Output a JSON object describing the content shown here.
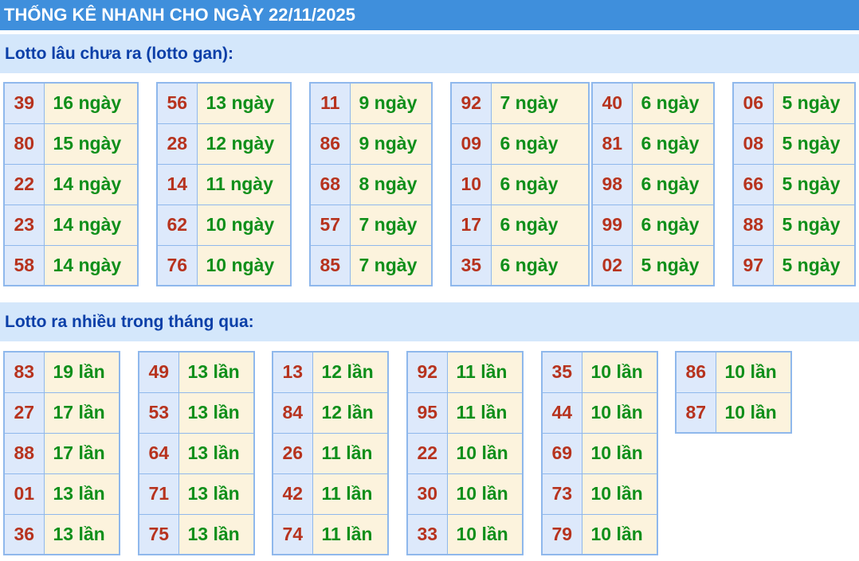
{
  "title": "THỐNG KÊ NHANH CHO NGÀY 22/11/2025",
  "gan": {
    "heading": "Lotto lâu chưa ra (lotto gan):",
    "tables": [
      [
        [
          "39",
          "16 ngày"
        ],
        [
          "80",
          "15 ngày"
        ],
        [
          "22",
          "14 ngày"
        ],
        [
          "23",
          "14 ngày"
        ],
        [
          "58",
          "14 ngày"
        ]
      ],
      [
        [
          "56",
          "13 ngày"
        ],
        [
          "28",
          "12 ngày"
        ],
        [
          "14",
          "11 ngày"
        ],
        [
          "62",
          "10 ngày"
        ],
        [
          "76",
          "10 ngày"
        ]
      ],
      [
        [
          "11",
          "9 ngày"
        ],
        [
          "86",
          "9 ngày"
        ],
        [
          "68",
          "8 ngày"
        ],
        [
          "57",
          "7 ngày"
        ],
        [
          "85",
          "7 ngày"
        ]
      ],
      [
        [
          "92",
          "7 ngày"
        ],
        [
          "09",
          "6 ngày"
        ],
        [
          "10",
          "6 ngày"
        ],
        [
          "17",
          "6 ngày"
        ],
        [
          "35",
          "6 ngày"
        ]
      ],
      [
        [
          "40",
          "6 ngày"
        ],
        [
          "81",
          "6 ngày"
        ],
        [
          "98",
          "6 ngày"
        ],
        [
          "99",
          "6 ngày"
        ],
        [
          "02",
          "5 ngày"
        ]
      ],
      [
        [
          "06",
          "5 ngày"
        ],
        [
          "08",
          "5 ngày"
        ],
        [
          "66",
          "5 ngày"
        ],
        [
          "88",
          "5 ngày"
        ],
        [
          "97",
          "5 ngày"
        ]
      ]
    ]
  },
  "nhieu": {
    "heading": "Lotto ra nhiều trong tháng qua:",
    "tables": [
      [
        [
          "83",
          "19 lần"
        ],
        [
          "27",
          "17 lần"
        ],
        [
          "88",
          "17 lần"
        ],
        [
          "01",
          "13 lần"
        ],
        [
          "36",
          "13 lần"
        ]
      ],
      [
        [
          "49",
          "13 lần"
        ],
        [
          "53",
          "13 lần"
        ],
        [
          "64",
          "13 lần"
        ],
        [
          "71",
          "13 lần"
        ],
        [
          "75",
          "13 lần"
        ]
      ],
      [
        [
          "13",
          "12 lần"
        ],
        [
          "84",
          "12 lần"
        ],
        [
          "26",
          "11 lần"
        ],
        [
          "42",
          "11 lần"
        ],
        [
          "74",
          "11 lần"
        ]
      ],
      [
        [
          "92",
          "11 lần"
        ],
        [
          "95",
          "11 lần"
        ],
        [
          "22",
          "10 lần"
        ],
        [
          "30",
          "10 lần"
        ],
        [
          "33",
          "10 lần"
        ]
      ],
      [
        [
          "35",
          "10 lần"
        ],
        [
          "44",
          "10 lần"
        ],
        [
          "69",
          "10 lần"
        ],
        [
          "73",
          "10 lần"
        ],
        [
          "79",
          "10 lần"
        ]
      ],
      [
        [
          "86",
          "10 lần"
        ],
        [
          "87",
          "10 lần"
        ]
      ]
    ]
  }
}
